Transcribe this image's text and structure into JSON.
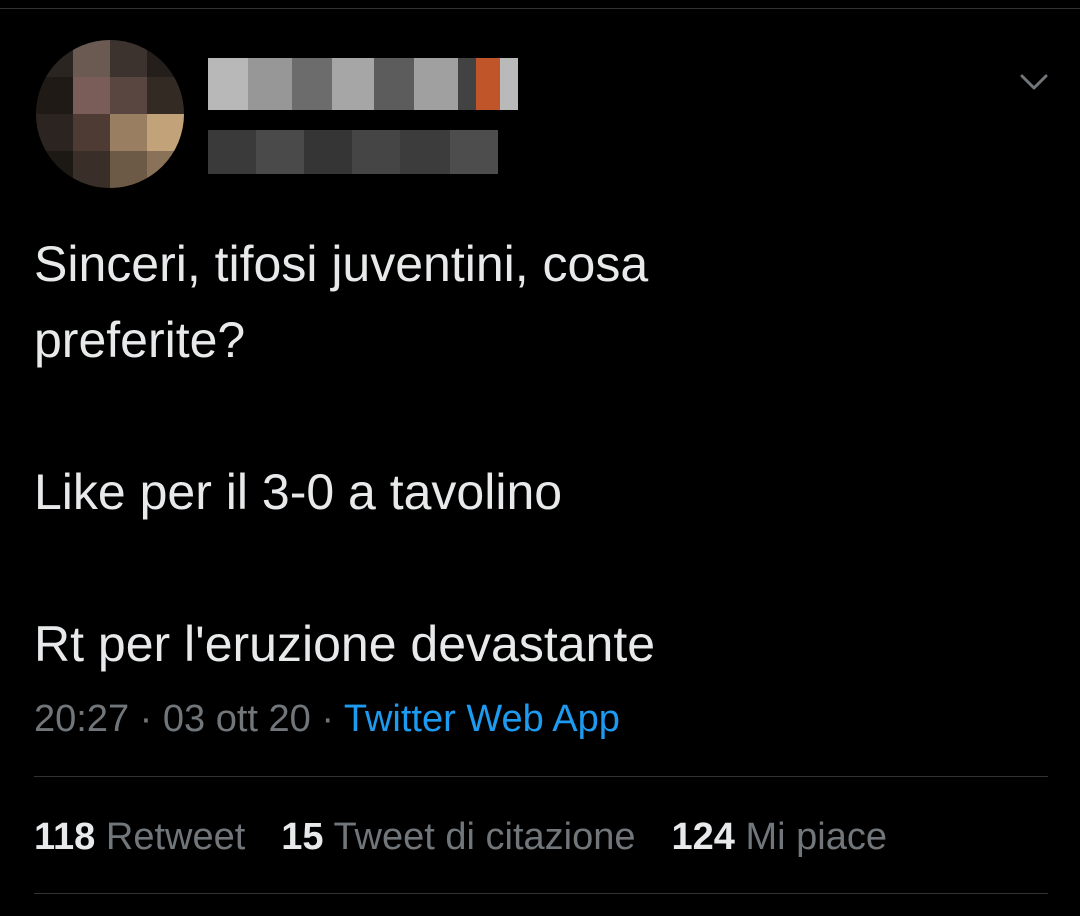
{
  "tweet": {
    "text": "Sinceri, tifosi juventini, cosa\npreferite?\n\nLike per il 3-0 a tavolino\n\nRt per l'eruzione devastante",
    "time": "20:27",
    "date": "03 ott 20",
    "separator": "·",
    "source": "Twitter Web App"
  },
  "stats": {
    "retweets_count": "118",
    "retweets_label": "Retweet",
    "quotes_count": "15",
    "quotes_label": "Tweet di citazione",
    "likes_count": "124",
    "likes_label": "Mi piace"
  },
  "icons": {
    "menu": "chevron-down-icon"
  },
  "colors": {
    "background": "#000000",
    "text": "#e7e9ea",
    "secondary": "#71767b",
    "link": "#1d9bf0",
    "divider": "#2f3336"
  }
}
